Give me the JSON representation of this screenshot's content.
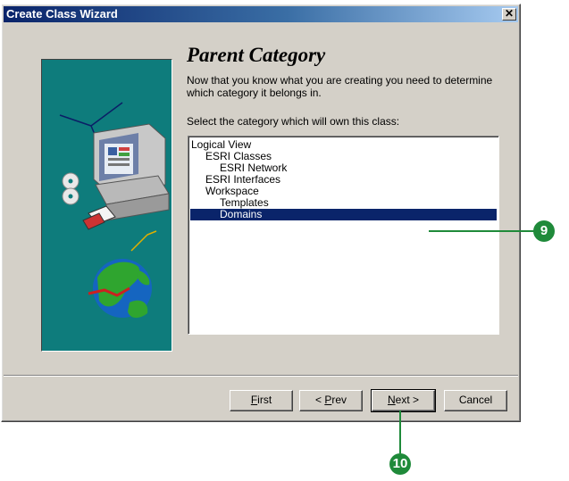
{
  "window": {
    "title": "Create Class Wizard",
    "close_glyph": "✕"
  },
  "page": {
    "heading": "Parent Category",
    "description": "Now that you know what you are creating you need to determine which category it belongs in.",
    "instruction": "Select the category which will own this class:"
  },
  "tree": {
    "items": [
      {
        "label": "Logical View",
        "level": 0,
        "selected": false
      },
      {
        "label": "ESRI Classes",
        "level": 1,
        "selected": false
      },
      {
        "label": "ESRI Network",
        "level": 2,
        "selected": false
      },
      {
        "label": "ESRI Interfaces",
        "level": 1,
        "selected": false
      },
      {
        "label": "Workspace",
        "level": 1,
        "selected": false
      },
      {
        "label": "Templates",
        "level": 2,
        "selected": false
      },
      {
        "label": "Domains",
        "level": 2,
        "selected": true
      }
    ]
  },
  "buttons": {
    "first": {
      "prefix": "",
      "underline": "F",
      "suffix": "irst"
    },
    "prev": {
      "prefix": "< ",
      "underline": "P",
      "suffix": "rev"
    },
    "next": {
      "prefix": "",
      "underline": "N",
      "suffix": "ext >"
    },
    "cancel": {
      "label": "Cancel"
    }
  },
  "callouts": {
    "step9": "9",
    "step10": "10"
  },
  "colors": {
    "title_bar": "#0a246a",
    "selection": "#0a246a",
    "art_background": "#0e7c7c",
    "callout": "#1f8a3a"
  }
}
